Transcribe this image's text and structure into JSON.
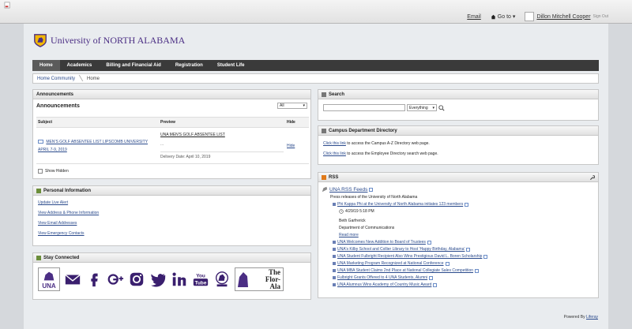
{
  "topbar": {
    "email_label": "Email",
    "goto_label": "Go to",
    "user_name": "Dillon Mitchell Cooper",
    "sign_out": "Sign Out"
  },
  "logo": {
    "text": "University of NORTH ALABAMA"
  },
  "nav": {
    "items": [
      {
        "label": "Home"
      },
      {
        "label": "Academics"
      },
      {
        "label": "Billing and Financial Aid"
      },
      {
        "label": "Registration"
      },
      {
        "label": "Student Life"
      }
    ]
  },
  "breadcrumb": {
    "parent": "Home Community",
    "current": "Home"
  },
  "announcements": {
    "title": "Announcements",
    "subtitle": "Announcements",
    "filter": "All",
    "columns": [
      "Subject",
      "Preview",
      "Hide"
    ],
    "row": {
      "subject": "MEN'S GOLF ABSENTEE LIST LIPSCOMB UNIVERSITY APRIL 7-9, 2019",
      "preview_title": "UNA MEN'S GOLF ABSENTEE LIST",
      "preview_dots": "...",
      "delivery": "Delivery Date: April 10, 2019",
      "hide": "Hide"
    },
    "show_hidden": "Show Hidden"
  },
  "personal": {
    "title": "Personal Information",
    "links": [
      "Update Live Alert",
      "View Address & Phone Information",
      "View Email Addresses",
      "View Emergency Contacts"
    ]
  },
  "stay": {
    "title": "Stay Connected",
    "una_label": "UNA",
    "flor_label": "The Flor-Ala",
    "icons": [
      "una-logo",
      "email",
      "facebook",
      "google-plus",
      "instagram",
      "twitter",
      "linkedin",
      "youtube",
      "lion-cam",
      "flor-ala"
    ]
  },
  "search": {
    "title": "Search",
    "scope": "Everything"
  },
  "directory": {
    "title": "Campus Department Directory",
    "line1_link": "Click this link",
    "line1_text": " to access the Campus A-Z Directory web page.",
    "line2_link": "Click this link",
    "line2_text": " to access the Employee Directory search web page."
  },
  "rss": {
    "title": "RSS",
    "feed_title": "UNA RSS Feeds",
    "description": "Press releases of the University of North Alabama",
    "first": {
      "title": "Phi Kappa Phi at the University of North Alabama initiates 123 members",
      "date": "4/29/19 5:18 PM",
      "author": "Beth Garfrerick",
      "dept": "Department of Communications",
      "more": "Read more"
    },
    "items": [
      "UNA Welcomes New Addition to Board of Trustees",
      "UNA's Kilby School and Collier Library to Host 'Happy Birthday, Alabama'",
      "UNA Student Fulbright Recipient Also Wins Prestigious David L. Boren Scholarship",
      "UNA Marketing Program Recognized at National Conference",
      "UNA MBA Student Claims 2nd Place at National Collegiate Sales Competition",
      "Fulbright Grants Offered to 4 UNA Students, Alumni",
      "UNA Alumnus Wins Academy of Country Music Award"
    ]
  },
  "footer": {
    "prefix": "Powered By ",
    "link": "Liferay"
  },
  "colors": {
    "brand_purple": "#4b2e84",
    "nav_bg": "#3a3a3a",
    "link": "#2a4a8c"
  }
}
